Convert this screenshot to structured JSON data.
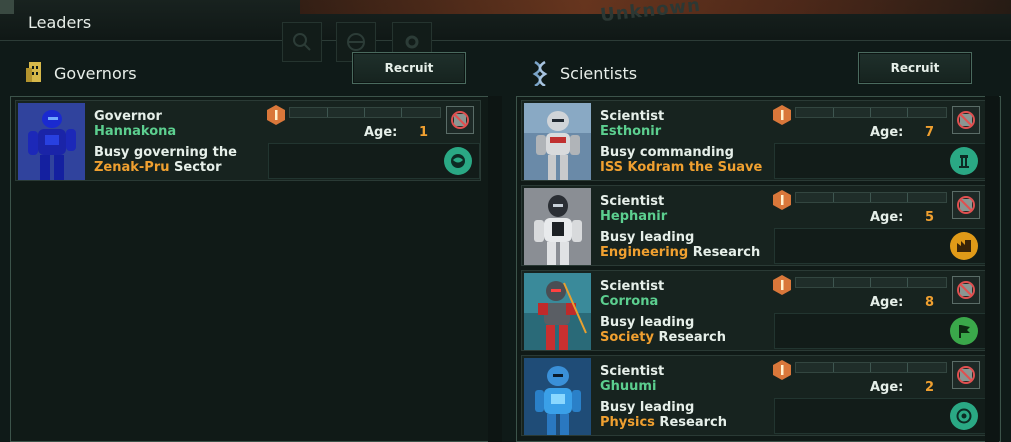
{
  "window": {
    "title": "Leaders",
    "watermark": "Unknown"
  },
  "governors": {
    "title": "Governors",
    "recruit_label": "Recruit",
    "leaders": [
      {
        "role": "Governor",
        "name": "Hannakona",
        "age_label": "Age:",
        "age": "1",
        "status_line1": "Busy governing the",
        "status_highlight": "Zenak-Pru",
        "status_rest": " Sector",
        "task_icon": "planet-icon",
        "task_color": "#2aa884"
      }
    ]
  },
  "scientists": {
    "title": "Scientists",
    "recruit_label": "Recruit",
    "leaders": [
      {
        "role": "Scientist",
        "name": "Esthonir",
        "age_label": "Age:",
        "age": "7",
        "status_line1": "Busy commanding",
        "status_highlight": "ISS Kodram the Suave",
        "status_rest": "",
        "task_icon": "science-ship-icon",
        "task_color": "#2aa884"
      },
      {
        "role": "Scientist",
        "name": "Hephanir",
        "age_label": "Age:",
        "age": "5",
        "status_line1": "Busy leading",
        "status_highlight": "Engineering",
        "status_rest": " Research",
        "task_icon": "engineering-icon",
        "task_color": "#e09a18"
      },
      {
        "role": "Scientist",
        "name": "Corrona",
        "age_label": "Age:",
        "age": "8",
        "status_line1": "Busy leading",
        "status_highlight": "Society",
        "status_rest": " Research",
        "task_icon": "society-icon",
        "task_color": "#3aa84a"
      },
      {
        "role": "Scientist",
        "name": "Ghuumi",
        "age_label": "Age:",
        "age": "2",
        "status_line1": "Busy leading",
        "status_highlight": "Physics",
        "status_rest": " Research",
        "task_icon": "physics-icon",
        "task_color": "#2aa884"
      }
    ]
  },
  "colors": {
    "name_green": "#5ccf8f",
    "highlight_orange": "#f0a030",
    "panel_border": "#3c534a"
  }
}
